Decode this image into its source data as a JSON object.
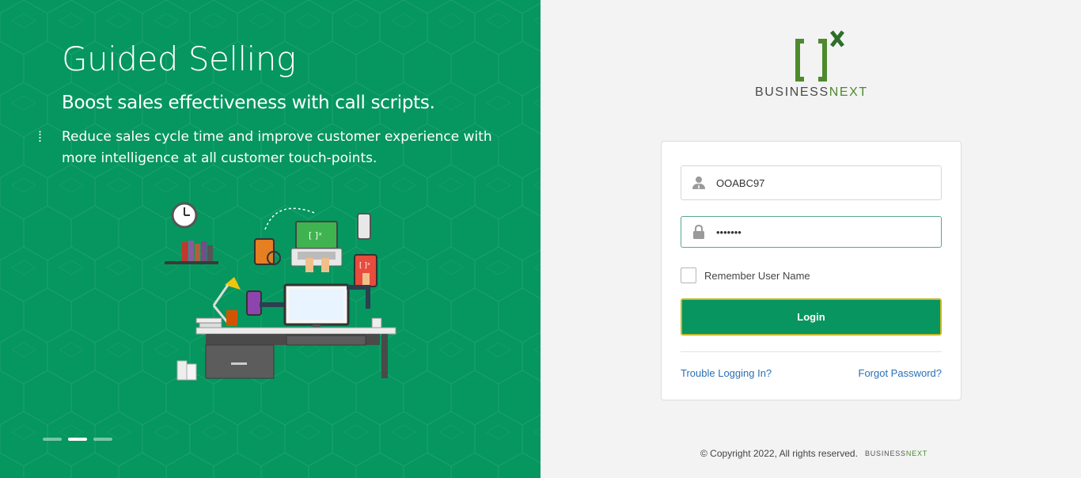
{
  "promo": {
    "title": "Guided Selling",
    "subtitle": "Boost sales effectiveness with call scripts.",
    "bullet": "Reduce sales cycle time and improve customer experience with more intelligence at all customer touch-points.",
    "carousel": {
      "count": 3,
      "active_index": 1
    }
  },
  "brand": {
    "logo_text_part1": "BUSINESS",
    "logo_text_part2": "NEXT",
    "accent_color": "#4d8a2d",
    "primary_green": "#06965f"
  },
  "login": {
    "username_value": "OOABC97",
    "password_value": "•••••••",
    "remember_label": "Remember User Name",
    "login_label": "Login",
    "trouble_label": "Trouble Logging In?",
    "forgot_label": "Forgot Password?"
  },
  "footer": {
    "copyright": "© Copyright 2022, All rights reserved.",
    "brand_part1": "BUSINESS",
    "brand_part2": "NEXT"
  },
  "icons": {
    "username": "user-icon",
    "password": "lock-icon"
  }
}
